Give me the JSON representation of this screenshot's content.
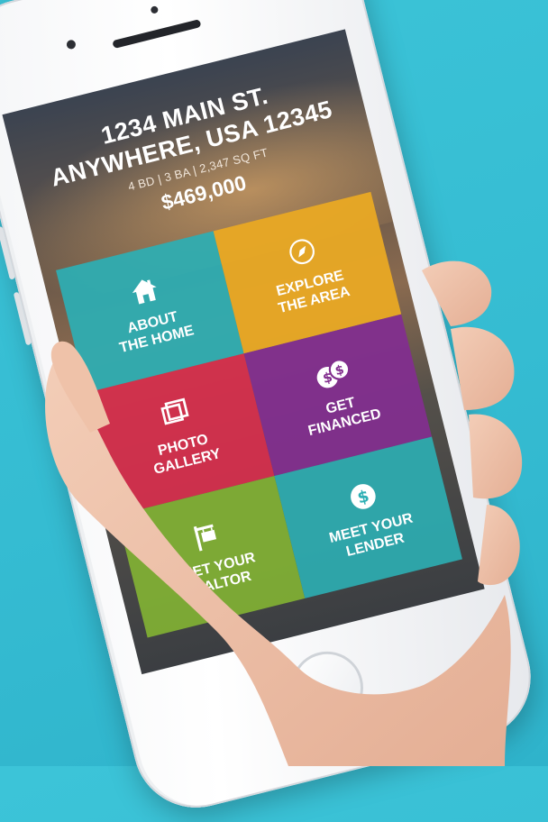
{
  "listing": {
    "address_line1": "1234 MAIN ST.",
    "address_line2": "ANYWHERE, USA 12345",
    "specs": "4 BD | 3 BA | 2,347 SQ FT",
    "price": "$469,000"
  },
  "tiles": [
    {
      "label": "ABOUT\nTHE HOME",
      "icon": "house-icon",
      "color": "#2cafb4"
    },
    {
      "label": "EXPLORE\nTHE AREA",
      "icon": "compass-icon",
      "color": "#e9a924"
    },
    {
      "label": "PHOTO\nGALLERY",
      "icon": "gallery-icon",
      "color": "#d62e4c"
    },
    {
      "label": "GET\nFINANCED",
      "icon": "dollar-coins-icon",
      "color": "#822e8e"
    },
    {
      "label": "MEET YOUR\nREALTOR",
      "icon": "for-sale-sign-icon",
      "color": "#81b034"
    },
    {
      "label": "MEET YOUR\nLENDER",
      "icon": "dollar-icon",
      "color": "#2cafb4"
    }
  ]
}
